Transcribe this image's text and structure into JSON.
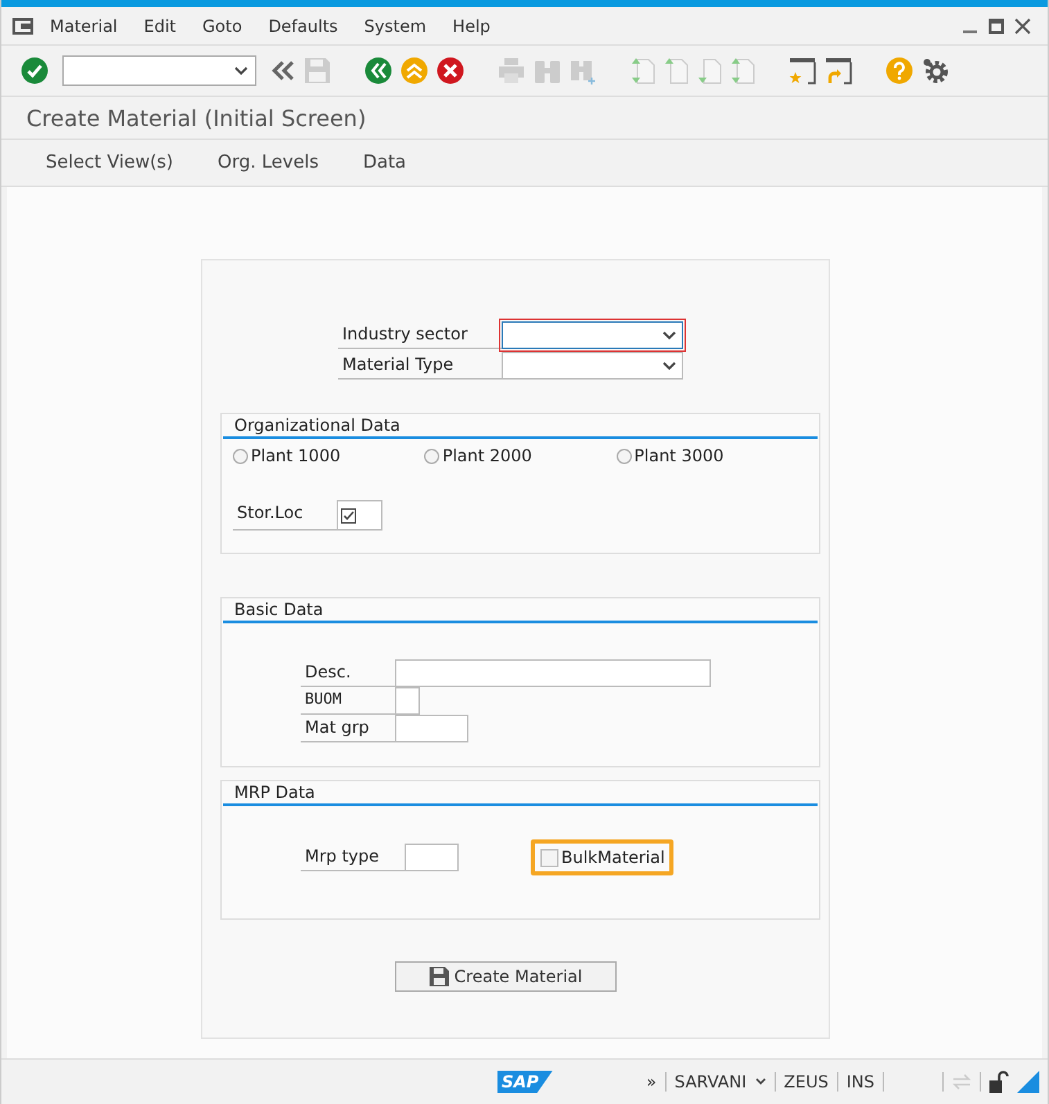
{
  "menu": [
    "Material",
    "Edit",
    "Goto",
    "Defaults",
    "System",
    "Help"
  ],
  "title": "Create Material (Initial Screen)",
  "app_toolbar": [
    "Select View(s)",
    "Org. Levels",
    "Data"
  ],
  "header_fields": [
    {
      "label": "Industry sector",
      "focused": true
    },
    {
      "label": "Material Type",
      "focused": false
    }
  ],
  "org_data": {
    "title": "Organizational Data",
    "radios": [
      {
        "label": "Plant 1000",
        "selected": false
      },
      {
        "label": "Plant 2000",
        "selected": false
      },
      {
        "label": "Plant 3000",
        "selected": false
      }
    ],
    "stor_loc": {
      "label": "Stor.Loc",
      "checked": true
    }
  },
  "basic_data": {
    "title": "Basic Data",
    "fields": [
      {
        "label": "Desc."
      },
      {
        "label": "BUOM"
      },
      {
        "label": "Mat grp"
      }
    ]
  },
  "mrp_data": {
    "title": "MRP Data",
    "field": {
      "label": "Mrp type"
    },
    "checkbox": {
      "label": "BulkMaterial",
      "checked": false,
      "highlighted": true
    }
  },
  "button": "Create Material",
  "status_bar": {
    "logo": "SAP",
    "expand": "»",
    "user": "SARVANI",
    "system": "ZEUS",
    "mode": "INS"
  }
}
